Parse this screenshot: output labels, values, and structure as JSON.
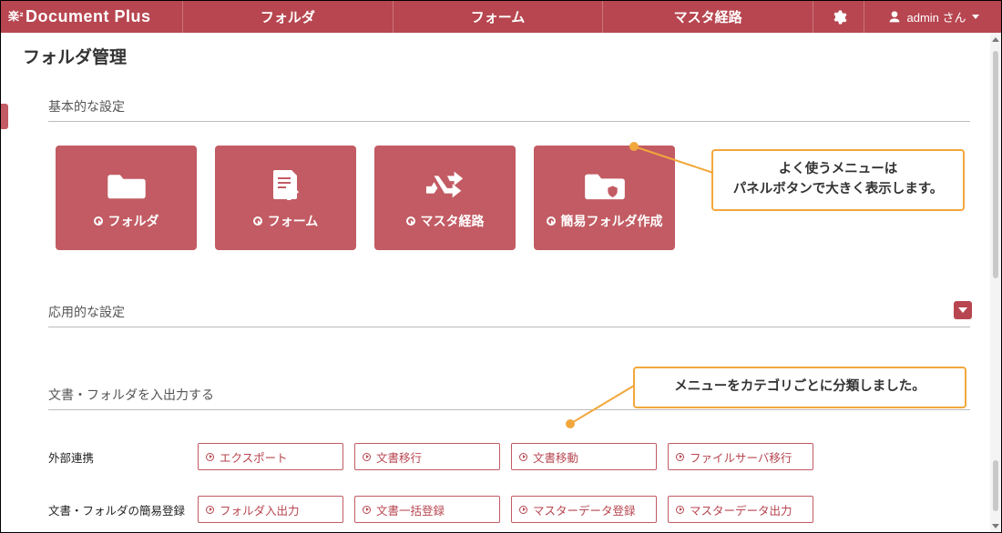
{
  "logo": {
    "prefix": "楽²",
    "main": "Document Plus"
  },
  "nav": {
    "folder": "フォルダ",
    "form": "フォーム",
    "master": "マスタ経路"
  },
  "user": {
    "name": "admin さん"
  },
  "page_title": "フォルダ管理",
  "section_basic": {
    "heading": "基本的な設定"
  },
  "panels": {
    "folder": {
      "label": "フォルダ"
    },
    "form": {
      "label": "フォーム"
    },
    "master": {
      "label": "マスタ経路"
    },
    "quick": {
      "label": "簡易フォルダ作成"
    }
  },
  "section_adv": {
    "heading": "応用的な設定"
  },
  "section_io": {
    "heading": "文書・フォルダを入出力する"
  },
  "rows": {
    "external": {
      "label": "外部連携",
      "items": [
        "エクスポート",
        "文書移行",
        "文書移動",
        "ファイルサーバ移行"
      ]
    },
    "easy_reg": {
      "label": "文書・フォルダの簡易登録",
      "items": [
        "フォルダ入出力",
        "文書一括登録",
        "マスターデータ登録",
        "マスターデータ出力"
      ]
    }
  },
  "callouts": {
    "panel": "よく使うメニューは\nパネルボタンで大きく表示します。",
    "category": "メニューをカテゴリごとに分類しました。"
  }
}
